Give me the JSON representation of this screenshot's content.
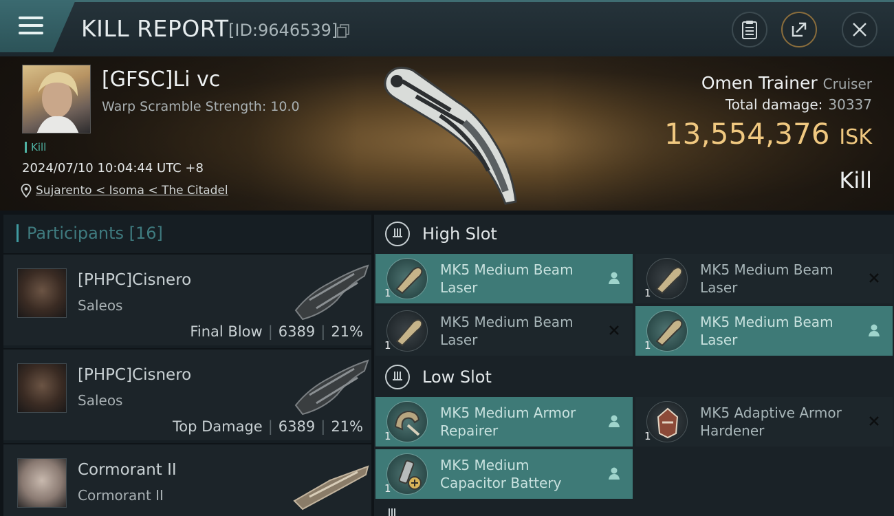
{
  "header": {
    "title": "KILL REPORT",
    "report_id": "[ID:9646539]"
  },
  "victim": {
    "name": "[GFSC]Li vc",
    "warp_scramble": "Warp Scramble Strength: 10.0",
    "kill_tag": "Kill",
    "datetime": "2024/07/10 10:04:44 UTC +8",
    "location": "Sujarento < Isoma < The Citadel",
    "ship_name": "Omen Trainer",
    "ship_class": "Cruiser",
    "total_damage_label": "Total damage:",
    "total_damage_value": "30337",
    "isk_value": "13,554,376",
    "isk_unit": "ISK",
    "result_label": "Kill"
  },
  "participants": {
    "title": "Participants [16]",
    "items": [
      {
        "name": "[PHPC]Cisnero",
        "ship": "Saleos",
        "role": "Final Blow",
        "damage": "6389",
        "percent": "21%"
      },
      {
        "name": "[PHPC]Cisnero",
        "ship": "Saleos",
        "role": "Top Damage",
        "damage": "6389",
        "percent": "21%"
      },
      {
        "name": "Cormorant II",
        "ship": "Cormorant II",
        "role": "",
        "damage": "",
        "percent": ""
      }
    ]
  },
  "fitting": {
    "high_slot": {
      "title": "High Slot",
      "modules": [
        {
          "qty": "1",
          "name_line1": "MK5 Medium Beam",
          "name_line2": "Laser",
          "status": "dropped"
        },
        {
          "qty": "1",
          "name_line1": "MK5 Medium Beam",
          "name_line2": "Laser",
          "status": "destroyed"
        },
        {
          "qty": "1",
          "name_line1": "MK5 Medium Beam",
          "name_line2": "Laser",
          "status": "destroyed"
        },
        {
          "qty": "1",
          "name_line1": "MK5 Medium Beam",
          "name_line2": "Laser",
          "status": "dropped"
        }
      ]
    },
    "low_slot": {
      "title": "Low Slot",
      "modules": [
        {
          "qty": "1",
          "name_line1": "MK5 Medium Armor",
          "name_line2": "Repairer",
          "status": "dropped"
        },
        {
          "qty": "1",
          "name_line1": "MK5 Adaptive Armor",
          "name_line2": "Hardener",
          "status": "destroyed"
        },
        {
          "qty": "1",
          "name_line1": "MK5 Medium",
          "name_line2": "Capacitor Battery",
          "status": "dropped"
        }
      ]
    }
  },
  "colors": {
    "accent": "#3f9aa0",
    "isk": "#f0c880",
    "active_module": "#3e7a77"
  }
}
